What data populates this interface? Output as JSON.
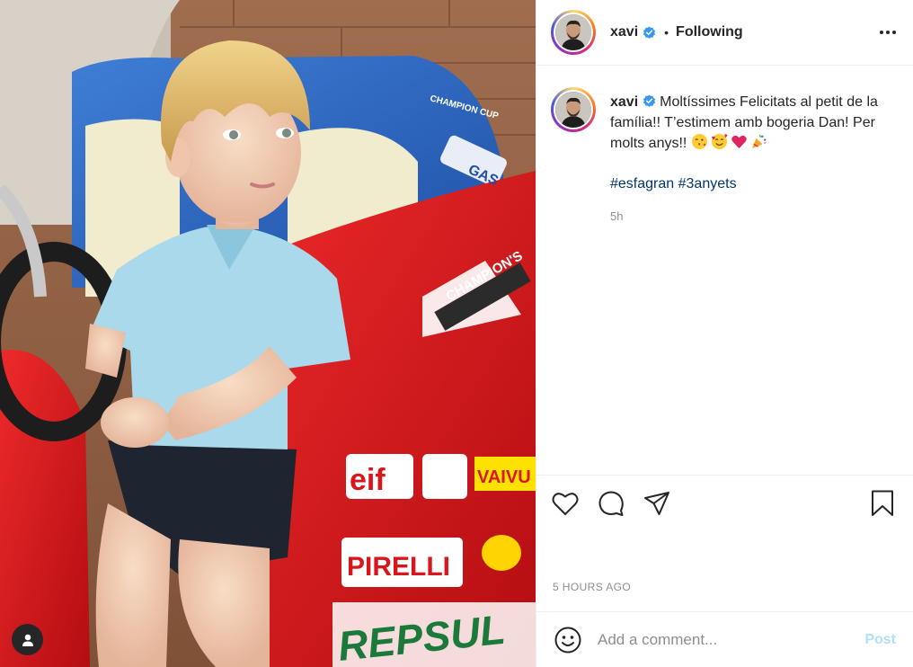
{
  "header": {
    "username": "xavi",
    "separator": "•",
    "follow_state": "Following"
  },
  "caption": {
    "username": "xavi",
    "text": "Moltíssimes Felicitats al petit de la família!! T’estimem amb bogeria Dan! Per molts anys!!",
    "emojis": [
      "face-blowing-kiss",
      "smiling-face-with-hearts",
      "red-heart",
      "party-popper"
    ],
    "hashtags": [
      "#esfagran",
      "#3anyets"
    ],
    "relative_time": "5h"
  },
  "photo": {
    "stickers": [
      "CHAMPION'S",
      "eif",
      "VAIVU",
      "PIRELLI",
      "REPSUL",
      "CHAMPION CUP",
      "GAS"
    ]
  },
  "footer": {
    "posted_time": "5 HOURS AGO",
    "comment_placeholder": "Add a comment...",
    "post_label": "Post"
  },
  "colors": {
    "verified_blue": "#3897f0",
    "hashtag": "#00376b",
    "post_disabled": "#b2dffc",
    "car_red": "#d8161c",
    "shirt_blue": "#a9d9ea"
  },
  "icons": [
    "verified-badge-icon",
    "more-options-icon",
    "heart-icon",
    "comment-icon",
    "share-icon",
    "bookmark-icon",
    "emoji-smiley-icon",
    "tagged-user-icon"
  ]
}
